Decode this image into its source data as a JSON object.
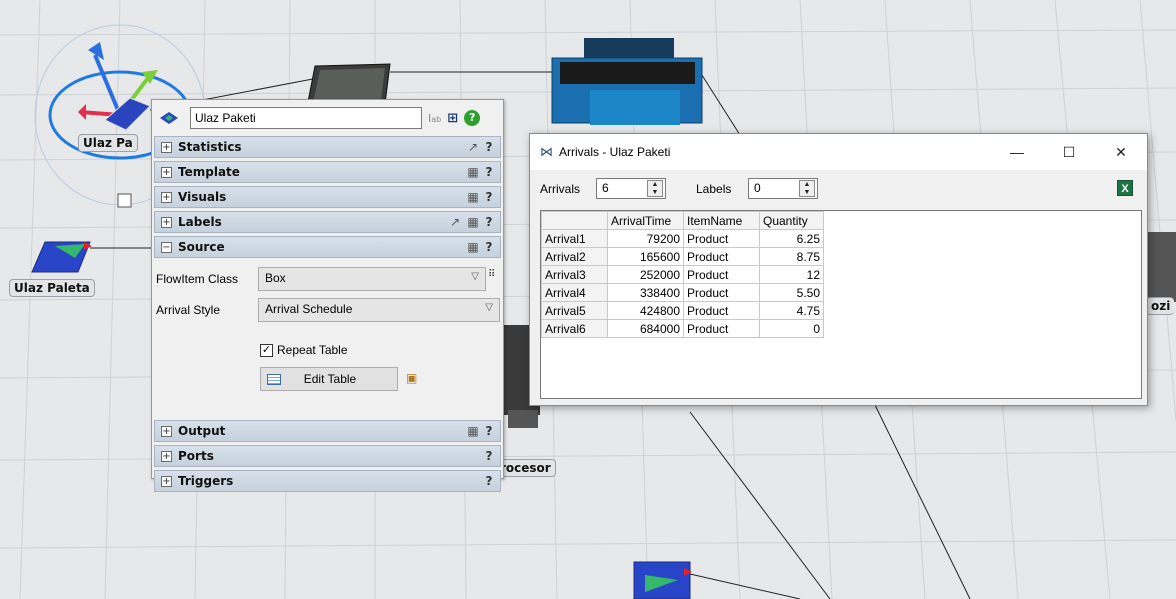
{
  "view": {
    "labels": {
      "ulaz_paketi": "Ulaz Pa",
      "ulaz_paleta": "Ulaz Paleta",
      "procesor": "rocesor",
      "right_obj": "ozi"
    }
  },
  "props": {
    "object_name": "Ulaz Paketi",
    "sections": {
      "statistics": "Statistics",
      "template": "Template",
      "visuals": "Visuals",
      "labels": "Labels",
      "source": "Source",
      "output": "Output",
      "ports": "Ports",
      "triggers": "Triggers"
    },
    "help": "?",
    "source": {
      "flowitem_label": "FlowItem Class",
      "flowitem_value": "Box",
      "arrival_label": "Arrival Style",
      "arrival_value": "Arrival Schedule",
      "repeat_label": "Repeat Table",
      "repeat_checked": true,
      "edit_table_label": "Edit Table"
    }
  },
  "arrivals": {
    "title": "Arrivals - Ulaz Paketi",
    "arrivals_label": "Arrivals",
    "arrivals_value": "6",
    "labels_label": "Labels",
    "labels_value": "0",
    "columns": [
      "ArrivalTime",
      "ItemName",
      "Quantity"
    ],
    "rows": [
      {
        "header": "Arrival1",
        "time": "79200",
        "item": "Product",
        "qty": "6.25"
      },
      {
        "header": "Arrival2",
        "time": "165600",
        "item": "Product",
        "qty": "8.75"
      },
      {
        "header": "Arrival3",
        "time": "252000",
        "item": "Product",
        "qty": "12"
      },
      {
        "header": "Arrival4",
        "time": "338400",
        "item": "Product",
        "qty": "5.50"
      },
      {
        "header": "Arrival5",
        "time": "424800",
        "item": "Product",
        "qty": "4.75"
      },
      {
        "header": "Arrival6",
        "time": "684000",
        "item": "Product",
        "qty": "0"
      }
    ]
  },
  "colors": {
    "section_bg": "#c6d1dd",
    "grid_bg": "#e6e8ea",
    "excel_green": "#1f7244"
  }
}
